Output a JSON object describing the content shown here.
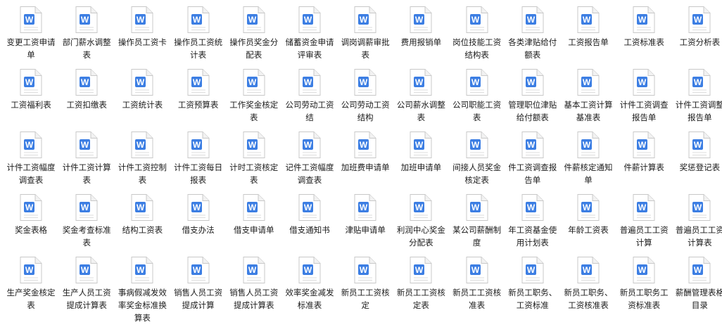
{
  "icon": "wps-word-document-icon",
  "icon_glyph": "W",
  "colors": {
    "icon_blue": "#3c7ee3",
    "page_stroke": "#c8c8c8",
    "page_fill": "#ffffff",
    "lines": "#dcdcdc",
    "text": "#1a1a1a"
  },
  "rows": [
    [
      "变更工资申请单",
      "部门薪水调整表",
      "操作员工资卡",
      "操作员工资统计表",
      "操作员奖金分配表",
      "储蓄资金申请评审表",
      "调岗调薪审批表",
      "费用报销单",
      "岗位技能工资结构表",
      "各类津贴给付额表",
      "工资报告单",
      "工资标准表",
      "工资分析表"
    ],
    [
      "工资福利表",
      "工资扣缴表",
      "工资统计表",
      "工资预算表",
      "工作奖金核定表",
      "公司劳动工资结",
      "公司劳动工资结构",
      "公司薪水调整表",
      "公司职能工资表",
      "管理职位津贴给付额表",
      "基本工资计算基准表",
      "计件工资调查报告单",
      "计件工资调整报告单"
    ],
    [
      "计件工资幅度调查表",
      "计件工资计算表",
      "计件工资控制表",
      "计件工资每日报表",
      "计时工资核定表",
      "记件工资幅度调查表",
      "加班费申请单",
      "加班申请单",
      "间接人员奖金核定表",
      "件工资调查报告单",
      "件薪核定通知单",
      "件薪计算表",
      "奖惩登记表"
    ],
    [
      "奖金表格",
      "奖金考查标准表",
      "结构工资表",
      "借支办法",
      "借支申请单",
      "借支通知书",
      "津贴申请单",
      "利润中心奖金分配表",
      "某公司薪酬制度",
      "年工资基金使用计划表",
      "年龄工资表",
      "普遍员工工资计算",
      "普遍员工工资计算表"
    ],
    [
      "生产奖金核定表",
      "生产人员工资提成计算表",
      "事病假减发效率奖金标准换算表",
      "销售人员工资提成计算",
      "销售人员工资提成计算表",
      "效率奖金减发标准表",
      "新员工工资核定",
      "新员工工资核定表",
      "新员工工资核准表",
      "新员工职务、工资标准",
      "新员工职务、工资核准表",
      "新员工职务工资标准表",
      "薪酬管理表格目录"
    ]
  ]
}
